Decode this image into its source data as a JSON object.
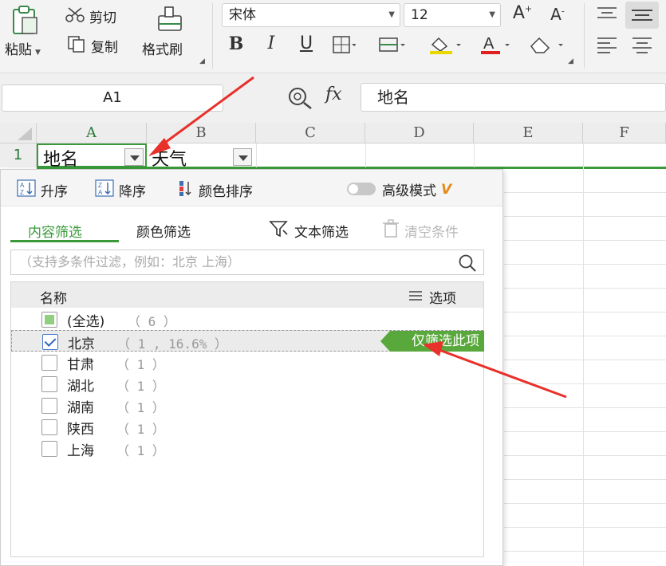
{
  "ribbon": {
    "paste": "粘贴",
    "cut": "剪切",
    "copy": "复制",
    "format_painter": "格式刷",
    "font_name": "宋体",
    "font_size": "12",
    "bold": "B",
    "italic": "I",
    "underline": "U"
  },
  "formula_bar": {
    "name_box": "A1",
    "fx": "fx",
    "content": "地名"
  },
  "grid": {
    "columns": [
      "A",
      "B",
      "C",
      "D",
      "E",
      "F"
    ],
    "row1_number": "1",
    "a1": "地名",
    "b1": "天气"
  },
  "filter": {
    "sort_asc": "升序",
    "sort_desc": "降序",
    "color_sort": "颜色排序",
    "advanced_mode": "高级模式",
    "advanced_badge": "V",
    "tab_content": "内容筛选",
    "tab_color": "颜色筛选",
    "text_filter": "文本筛选",
    "clear_conditions": "清空条件",
    "search_placeholder": "（支持多条件过滤，例如：北京 上海）",
    "list_header": "名称",
    "options": "选项",
    "select_all": "(全选)",
    "select_all_count": "（ 6 ）",
    "only_this": "仅筛选此项",
    "items": [
      {
        "name": "北京",
        "count": "（ 1 , 16.6% ）",
        "checked": true
      },
      {
        "name": "甘肃",
        "count": "（ 1 ）",
        "checked": false
      },
      {
        "name": "湖北",
        "count": "（ 1 ）",
        "checked": false
      },
      {
        "name": "湖南",
        "count": "（ 1 ）",
        "checked": false
      },
      {
        "name": "陕西",
        "count": "（ 1 ）",
        "checked": false
      },
      {
        "name": "上海",
        "count": "（ 1 ）",
        "checked": false
      }
    ]
  },
  "colors": {
    "accent_green": "#3a9a3a",
    "only_button": "#59a83b",
    "annotation_arrow": "#e8312a"
  }
}
